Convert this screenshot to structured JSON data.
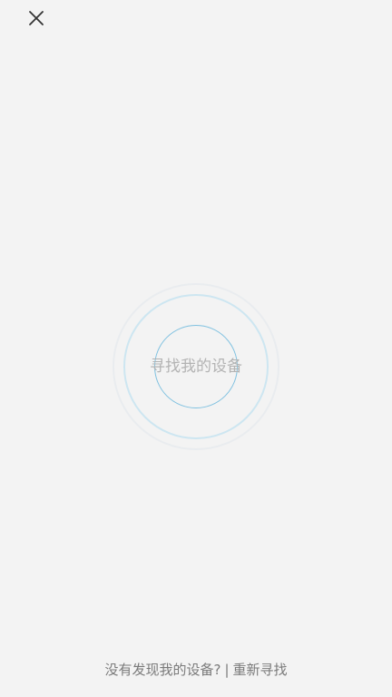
{
  "header": {
    "close_icon": "close-icon"
  },
  "scanner": {
    "label": "寻找我的设备"
  },
  "footer": {
    "not_found_text": "没有发现我的设备?",
    "separator": "|",
    "retry_label": "重新寻找"
  },
  "colors": {
    "background": "#f3f3f3",
    "ring_inner": "#7fc1e0",
    "ring_middle": "#cde6f1",
    "ring_outer": "#e9ecef",
    "label_text": "#b3b3b3",
    "footer_text": "#7a7a7a"
  }
}
